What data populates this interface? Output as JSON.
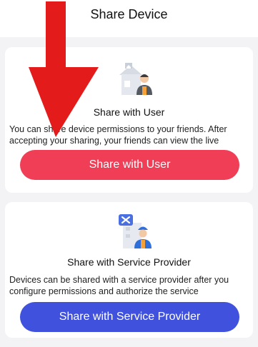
{
  "header": {
    "title": "Share Device"
  },
  "share_user": {
    "title": "Share with User",
    "description": "You can share device permissions to your friends. After accepting your sharing, your friends can view the live",
    "button_label": "Share with User",
    "button_color": "#ef3e56",
    "icon": "house-person-icon"
  },
  "share_provider": {
    "title": "Share with Service Provider",
    "description": "Devices can be shared with a service provider after you configure permissions and authorize the service",
    "button_label": "Share with Service Provider",
    "button_color": "#3f51dd",
    "icon": "service-worker-icon"
  },
  "annotation": {
    "icon": "red-down-arrow",
    "color": "#e31b1b"
  }
}
